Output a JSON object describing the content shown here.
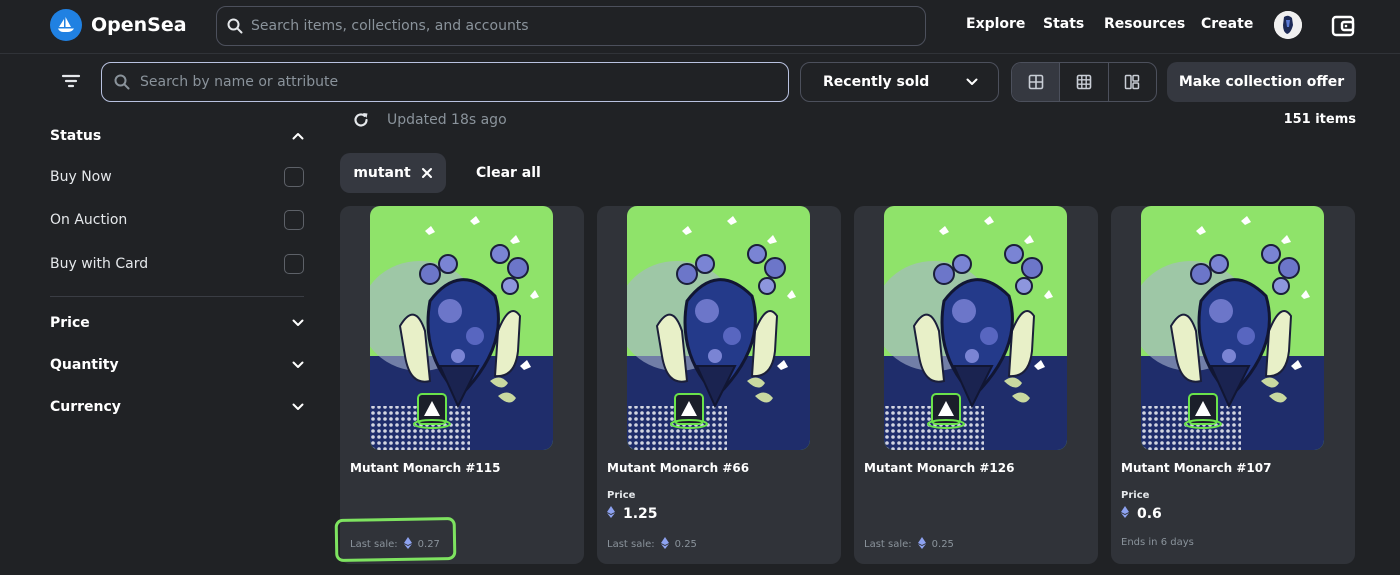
{
  "brand": {
    "name": "OpenSea"
  },
  "global_search": {
    "placeholder": "Search items, collections, and accounts"
  },
  "nav": {
    "explore": "Explore",
    "stats": "Stats",
    "resources": "Resources",
    "create": "Create"
  },
  "toolbar": {
    "search_placeholder": "Search by name or attribute",
    "sort_value": "Recently sold",
    "offer_label": "Make collection offer",
    "view_modes": [
      "large-grid-icon",
      "small-grid-icon",
      "mixed-grid-icon"
    ]
  },
  "sidebar": {
    "status_label": "Status",
    "status_options": [
      "Buy Now",
      "On Auction",
      "Buy with Card"
    ],
    "price_label": "Price",
    "quantity_label": "Quantity",
    "currency_label": "Currency"
  },
  "results": {
    "updated": "Updated 18s ago",
    "count": "151 items",
    "chip": "mutant",
    "clear_all": "Clear all"
  },
  "cards": [
    {
      "name": "Mutant Monarch #115",
      "price_label": "",
      "price": "",
      "footer_label": "Last sale:",
      "footer_value": "0.27"
    },
    {
      "name": "Mutant Monarch #66",
      "price_label": "Price",
      "price": "1.25",
      "footer_label": "Last sale:",
      "footer_value": "0.25"
    },
    {
      "name": "Mutant Monarch #126",
      "price_label": "",
      "price": "",
      "footer_label": "Last sale:",
      "footer_value": "0.25"
    },
    {
      "name": "Mutant Monarch #107",
      "price_label": "Price",
      "price": "0.6",
      "footer_label": "Ends in 6 days",
      "footer_value": ""
    }
  ],
  "colors": {
    "background": "#202225",
    "card": "#303339",
    "accent": "#2081e2",
    "highlight": "#7ee360",
    "art_green": "#8fe36a",
    "art_navy": "#1f2d6b"
  }
}
